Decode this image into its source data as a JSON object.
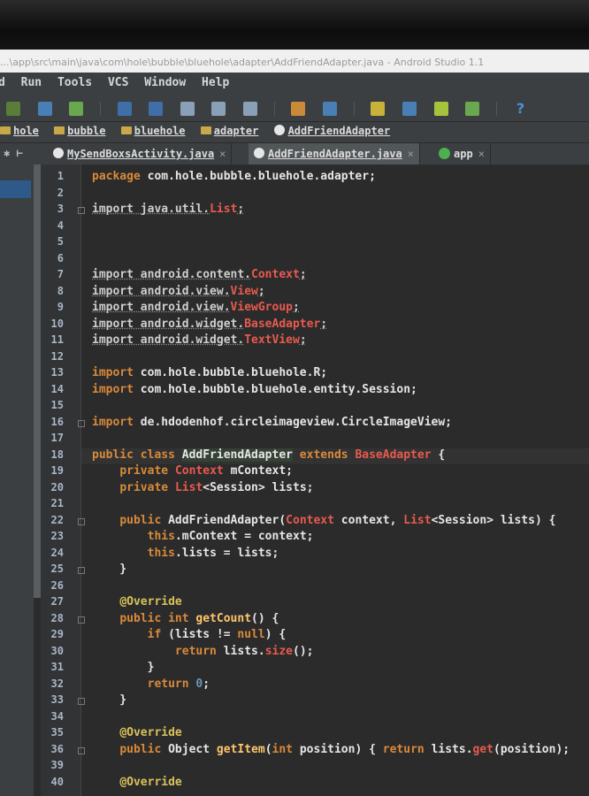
{
  "window": {
    "title": "...\\app\\src\\main\\java\\com\\hole\\bubble\\bluehole\\adapter\\AddFriendAdapter.java - Android Studio 1.1"
  },
  "menu": {
    "items": [
      "d",
      "Run",
      "Tools",
      "VCS",
      "Window",
      "Help"
    ]
  },
  "breadcrumbs": [
    "hole",
    "bubble",
    "bluehole",
    "adapter",
    "AddFriendAdapter"
  ],
  "tabs": [
    {
      "label": "MySendBoxsActivity.java",
      "close": "×",
      "active": false
    },
    {
      "label": "AddFriendAdapter.java",
      "close": "×",
      "active": true
    },
    {
      "label": "app",
      "close": "×",
      "active": false
    }
  ],
  "colors": {
    "keyword": "#d98a3a",
    "error": "#e85a4f",
    "annotation": "#d8c35a",
    "number": "#6897bb",
    "method": "#ffc66d",
    "editor_bg": "#2b2b2b",
    "chrome_bg": "#3c3f41"
  },
  "code_lines": [
    [
      [
        "k",
        "package "
      ],
      [
        "t",
        "com.hole.bubble.bluehole.adapter;"
      ]
    ],
    [],
    [
      [
        "dim",
        "import java.util."
      ],
      [
        "r",
        "List"
      ],
      [
        "dim",
        ";"
      ]
    ],
    [],
    [],
    [],
    [
      [
        "dim",
        "import android.content."
      ],
      [
        "r",
        "Context"
      ],
      [
        "dim",
        ";"
      ]
    ],
    [
      [
        "dim",
        "import android.view."
      ],
      [
        "r",
        "View"
      ],
      [
        "dim",
        ";"
      ]
    ],
    [
      [
        "dim",
        "import android.view."
      ],
      [
        "r",
        "ViewGroup"
      ],
      [
        "dim",
        ";"
      ]
    ],
    [
      [
        "dim",
        "import android.widget."
      ],
      [
        "r",
        "BaseAdapter"
      ],
      [
        "dim",
        ";"
      ]
    ],
    [
      [
        "dim",
        "import android.widget."
      ],
      [
        "r",
        "TextView"
      ],
      [
        "dim",
        ";"
      ]
    ],
    [],
    [
      [
        "k",
        "import "
      ],
      [
        "t",
        "com.hole.bubble.bluehole.R;"
      ]
    ],
    [
      [
        "k",
        "import "
      ],
      [
        "t",
        "com.hole.bubble.bluehole.entity.Session;"
      ]
    ],
    [],
    [
      [
        "k",
        "import "
      ],
      [
        "t",
        "de.hdodenhof.circleimageview.CircleImageView;"
      ]
    ],
    [],
    [
      [
        "k",
        "public class "
      ],
      [
        "cls",
        "AddFriendAdapter"
      ],
      [
        "k",
        " extends "
      ],
      [
        "r",
        "BaseAdapter"
      ],
      [
        "t",
        " {"
      ]
    ],
    [
      [
        "t",
        "    "
      ],
      [
        "k",
        "private "
      ],
      [
        "r",
        "Context "
      ],
      [
        "t",
        "mContext;"
      ]
    ],
    [
      [
        "t",
        "    "
      ],
      [
        "k",
        "private "
      ],
      [
        "r",
        "List"
      ],
      [
        "t",
        "<Session> lists;"
      ]
    ],
    [],
    [
      [
        "t",
        "    "
      ],
      [
        "k",
        "public "
      ],
      [
        "t",
        "AddFriendAdapter("
      ],
      [
        "r",
        "Context"
      ],
      [
        "t",
        " context, "
      ],
      [
        "r",
        "List"
      ],
      [
        "t",
        "<Session> lists) {"
      ]
    ],
    [
      [
        "t",
        "        "
      ],
      [
        "k",
        "this"
      ],
      [
        "t",
        ".mContext = context;"
      ]
    ],
    [
      [
        "t",
        "        "
      ],
      [
        "k",
        "this"
      ],
      [
        "t",
        ".lists = lists;"
      ]
    ],
    [
      [
        "t",
        "    }"
      ]
    ],
    [],
    [
      [
        "t",
        "    "
      ],
      [
        "ann",
        "@Override"
      ]
    ],
    [
      [
        "t",
        "    "
      ],
      [
        "k",
        "public int "
      ],
      [
        "m",
        "getCount"
      ],
      [
        "t",
        "() {"
      ]
    ],
    [
      [
        "t",
        "        "
      ],
      [
        "k",
        "if "
      ],
      [
        "t",
        "(lists != "
      ],
      [
        "k",
        "null"
      ],
      [
        "t",
        ") {"
      ]
    ],
    [
      [
        "t",
        "            "
      ],
      [
        "k",
        "return "
      ],
      [
        "t",
        "lists."
      ],
      [
        "r",
        "size"
      ],
      [
        "t",
        "();"
      ]
    ],
    [
      [
        "t",
        "        }"
      ]
    ],
    [
      [
        "t",
        "        "
      ],
      [
        "k",
        "return "
      ],
      [
        "n",
        "0"
      ],
      [
        "t",
        ";"
      ]
    ],
    [
      [
        "t",
        "    }"
      ]
    ],
    [],
    [
      [
        "t",
        "    "
      ],
      [
        "ann",
        "@Override"
      ]
    ],
    [
      [
        "t",
        "    "
      ],
      [
        "k",
        "public "
      ],
      [
        "t",
        "Object "
      ],
      [
        "m",
        "getItem"
      ],
      [
        "t",
        "("
      ],
      [
        "k",
        "int "
      ],
      [
        "t",
        "position) { "
      ],
      [
        "k",
        "return "
      ],
      [
        "t",
        "lists."
      ],
      [
        "r",
        "get"
      ],
      [
        "t",
        "(position);"
      ]
    ],
    [],
    [
      [
        "t",
        "    "
      ],
      [
        "ann",
        "@Override"
      ]
    ]
  ],
  "line_numbers": [
    "1",
    "2",
    "3",
    "4",
    "5",
    "6",
    "7",
    "8",
    "9",
    "10",
    "11",
    "12",
    "13",
    "14",
    "15",
    "16",
    "17",
    "18",
    "19",
    "20",
    "21",
    "22",
    "23",
    "24",
    "25",
    "26",
    "27",
    "28",
    "29",
    "30",
    "31",
    "32",
    "33",
    "34",
    "35",
    "36",
    "39",
    "40"
  ],
  "fold_markers": [
    3,
    16,
    22,
    25,
    28,
    33,
    36
  ]
}
